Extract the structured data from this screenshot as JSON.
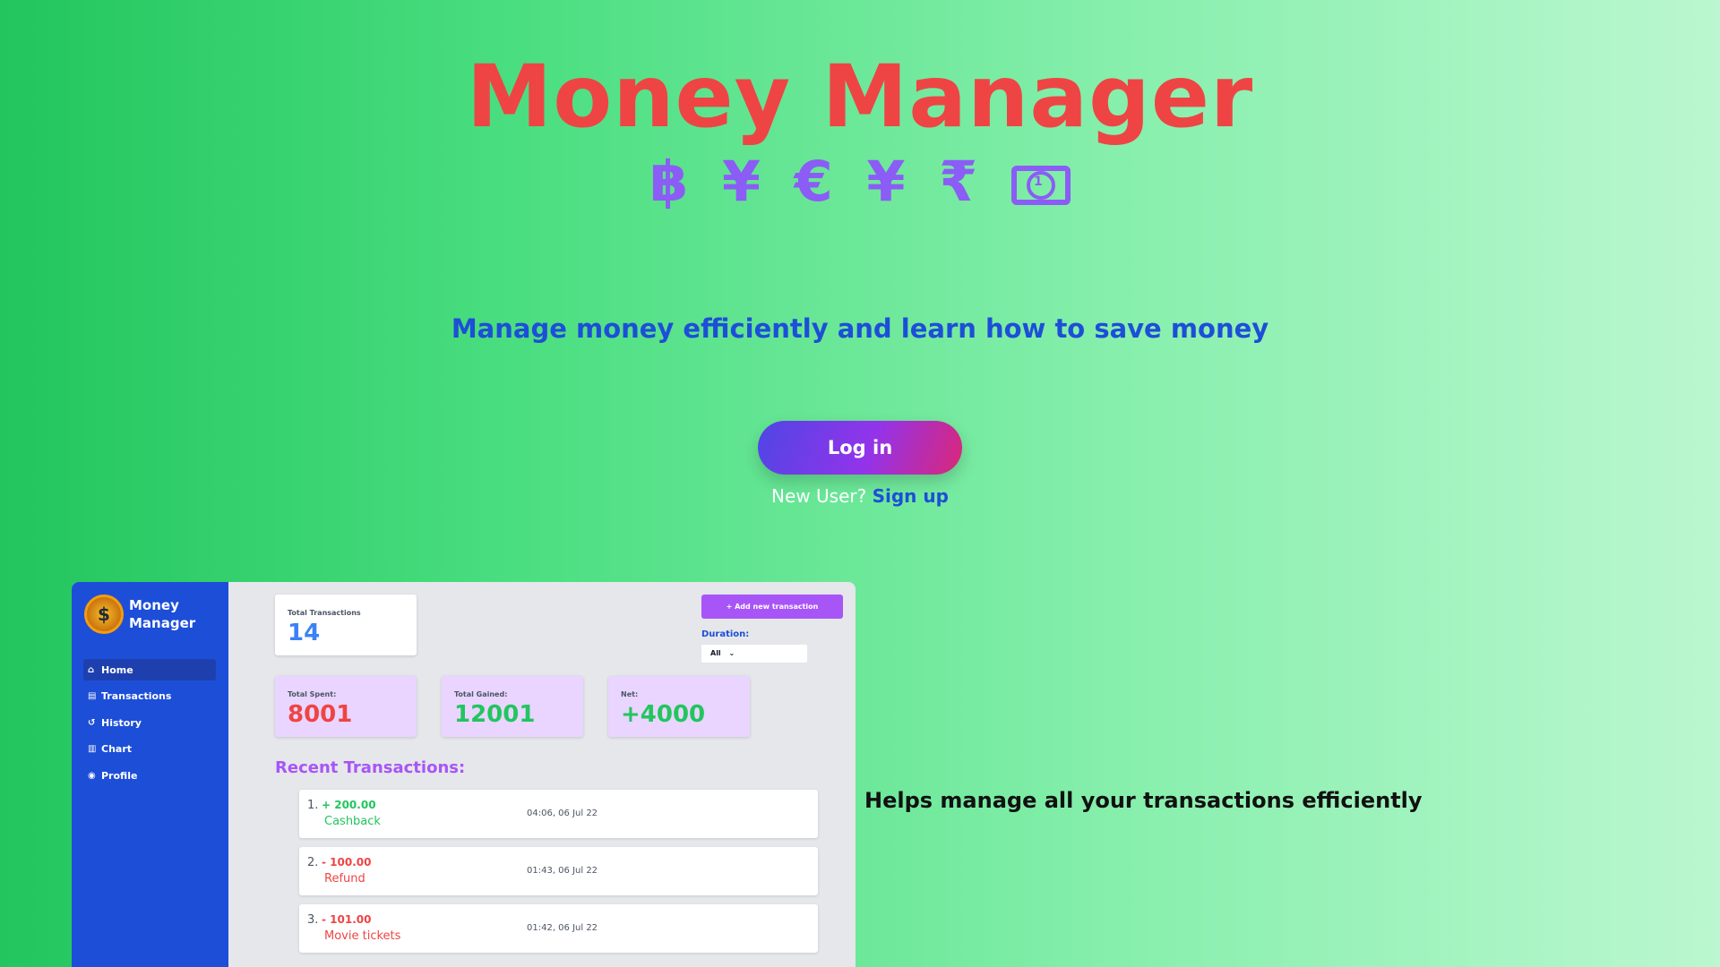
{
  "hero": {
    "title": "Money Manager",
    "currency_symbols": [
      "฿",
      "¥",
      "€",
      "¥",
      "₹"
    ],
    "currency_extra_icon": "banknote-icon",
    "tagline": "Manage money efficiently and learn how to save money",
    "login_label": "Log in",
    "signup_prompt": "New User?",
    "signup_label": "Sign up"
  },
  "colors": {
    "title": "#ef4444",
    "tagline": "#1d4ed8",
    "currency": "#8b5cf6",
    "sidebar": "#1d4ed8",
    "accent": "#a855f7"
  },
  "preview": {
    "brand": {
      "logo_icon": "coin-logo-icon",
      "name": "Money Manager"
    },
    "nav": [
      {
        "label": "Home",
        "icon": "home-icon",
        "glyph": "⌂",
        "active": true
      },
      {
        "label": "Transactions",
        "icon": "book-icon",
        "glyph": "▤",
        "active": false
      },
      {
        "label": "History",
        "icon": "history-icon",
        "glyph": "↺",
        "active": false
      },
      {
        "label": "Chart",
        "icon": "bar-chart-icon",
        "glyph": "▥",
        "active": false
      },
      {
        "label": "Profile",
        "icon": "user-circle-icon",
        "glyph": "◉",
        "active": false
      }
    ],
    "total_transactions": {
      "label": "Total Transactions",
      "value": "14"
    },
    "add_button_label": "+ Add new transaction",
    "duration": {
      "label": "Duration:",
      "selected": "All"
    },
    "stats": [
      {
        "label": "Total Spent:",
        "value": "8001",
        "tone": "red"
      },
      {
        "label": "Total Gained:",
        "value": "12001",
        "tone": "green"
      },
      {
        "label": "Net:",
        "value": "+4000",
        "tone": "green"
      }
    ],
    "recent_title": "Recent Transactions:",
    "transactions": [
      {
        "num": "1.",
        "amount": "+ 200.00",
        "desc": "Cashback",
        "time": "04:06, 06 Jul 22",
        "tone": "green"
      },
      {
        "num": "2.",
        "amount": "- 100.00",
        "desc": "Refund",
        "time": "01:43, 06 Jul 22",
        "tone": "red"
      },
      {
        "num": "3.",
        "amount": "- 101.00",
        "desc": "Movie tickets",
        "time": "01:42, 06 Jul 22",
        "tone": "red"
      }
    ]
  },
  "feature_text": "Helps manage all your transactions efficiently"
}
